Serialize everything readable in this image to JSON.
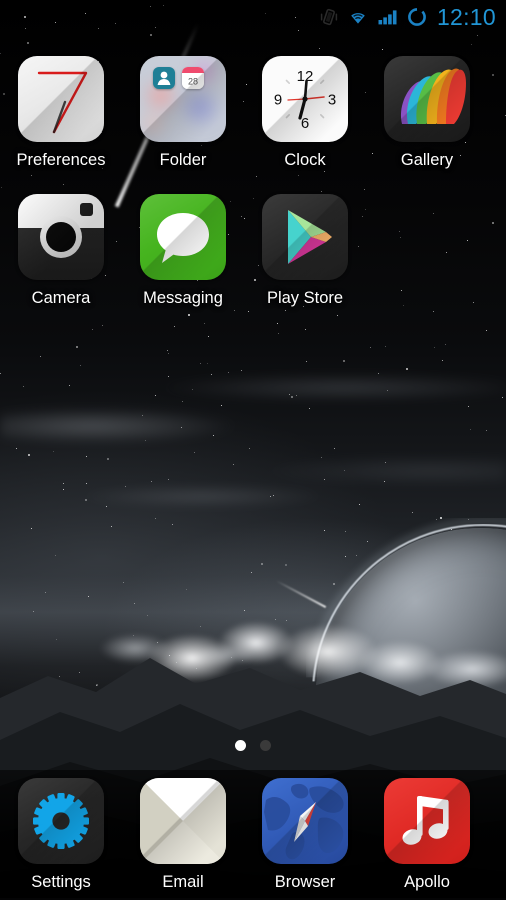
{
  "status_bar": {
    "time": "12:10",
    "time_color": "#2196d6",
    "icons": [
      {
        "name": "vibrate-icon",
        "label": "Vibrate mode"
      },
      {
        "name": "wifi-icon",
        "label": "Wi-Fi connected"
      },
      {
        "name": "signal-icon",
        "label": "Cellular signal full"
      },
      {
        "name": "battery-circle-icon",
        "label": "Battery"
      }
    ]
  },
  "home_screen": {
    "rows": [
      {
        "apps": [
          {
            "label": "Preferences",
            "icon": "preferences-icon"
          },
          {
            "label": "Folder",
            "icon": "folder-icon"
          },
          {
            "label": "Clock",
            "icon": "clock-icon"
          },
          {
            "label": "Gallery",
            "icon": "gallery-icon"
          }
        ]
      },
      {
        "apps": [
          {
            "label": "Camera",
            "icon": "camera-icon"
          },
          {
            "label": "Messaging",
            "icon": "messaging-icon"
          },
          {
            "label": "Play Store",
            "icon": "play-store-icon"
          }
        ]
      }
    ]
  },
  "clock_icon": {
    "numerals": [
      "12",
      "3",
      "6",
      "9"
    ],
    "hand_color": "#111111",
    "second_hand_color": "#e0362c"
  },
  "page_indicator": {
    "total": 2,
    "current": 1,
    "active_color": "#ffffff",
    "inactive_color": "#3a3a3a"
  },
  "dock": {
    "apps": [
      {
        "label": "Settings",
        "icon": "settings-gear-icon",
        "accent": "#12a5e8"
      },
      {
        "label": "Email",
        "icon": "envelope-icon",
        "accent": "#e8e6dc"
      },
      {
        "label": "Browser",
        "icon": "compass-globe-icon",
        "accent": "#2f58b4"
      },
      {
        "label": "Apollo",
        "icon": "music-note-icon",
        "accent": "#e02a25"
      }
    ]
  },
  "wallpaper": {
    "name": "space-landscape-wallpaper",
    "description": "Dark monochrome sci-fi landscape with stars, a large planet on the right horizon, bright clouds and mountains"
  }
}
